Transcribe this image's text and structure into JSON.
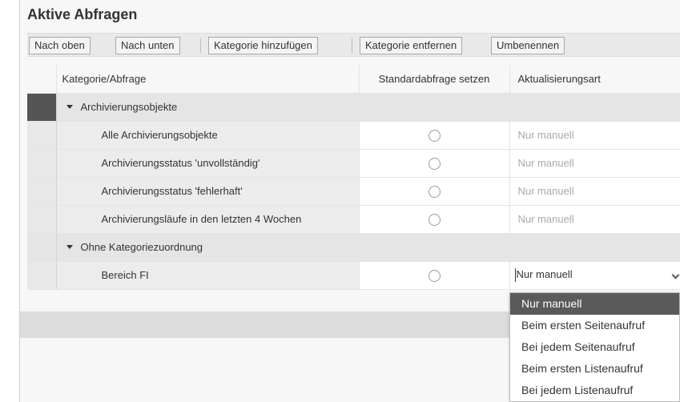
{
  "title": "Aktive Abfragen",
  "toolbar": {
    "move_up": "Nach oben",
    "move_down": "Nach unten",
    "add_category": "Kategorie hinzufügen",
    "remove_category": "Kategorie entfernen",
    "rename": "Umbenennen"
  },
  "table": {
    "headers": {
      "name": "Kategorie/Abfrage",
      "default_query": "Standardabfrage setzen",
      "update_type": "Aktualisierungsart"
    },
    "categories": [
      {
        "label": "Archivierungsobjekte",
        "rows": [
          {
            "name": "Alle Archivierungsobjekte",
            "update": "Nur manuell"
          },
          {
            "name": "Archivierungsstatus 'unvollständig'",
            "update": "Nur manuell"
          },
          {
            "name": "Archivierungsstatus 'fehlerhaft'",
            "update": "Nur manuell"
          },
          {
            "name": "Archivierungsläufe in den letzten 4 Wochen",
            "update": "Nur manuell"
          }
        ]
      },
      {
        "label": "Ohne Kategoriezuordnung",
        "rows": [
          {
            "name": "Bereich FI",
            "update": "Nur manuell"
          }
        ]
      }
    ]
  },
  "dropdown": {
    "selected": "Nur manuell",
    "options": [
      "Nur manuell",
      "Beim ersten Seitenaufruf",
      "Bei jedem Seitenaufruf",
      "Beim ersten Listenaufruf",
      "Bei jedem Listenaufruf"
    ]
  }
}
